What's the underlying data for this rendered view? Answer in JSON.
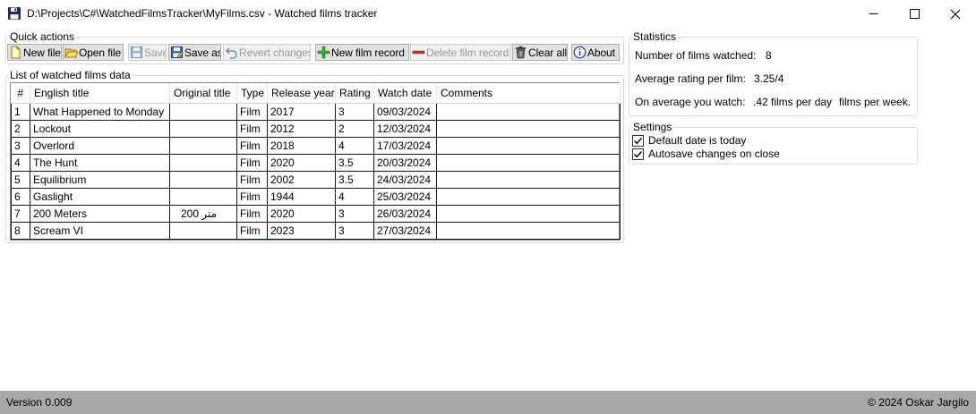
{
  "window": {
    "title": "D:\\Projects\\C#\\WatchedFilmsTracker\\MyFilms.csv - Watched films tracker",
    "app_icon": "floppy-disk-icon",
    "minimize_icon": "minimize-icon",
    "maximize_icon": "maximize-icon",
    "close_icon": "close-icon"
  },
  "quick_actions": {
    "label": "Quick actions",
    "buttons": [
      {
        "label": "New file",
        "icon": "new-file-icon",
        "enabled": true
      },
      {
        "label": "Open file",
        "icon": "open-folder-icon",
        "enabled": true
      },
      {
        "label": "Save",
        "icon": "save-icon",
        "enabled": false
      },
      {
        "label": "Save as",
        "icon": "save-as-icon",
        "enabled": true
      },
      {
        "label": "Revert changes",
        "icon": "undo-icon",
        "enabled": false
      },
      {
        "label": "New film record",
        "icon": "plus-icon",
        "enabled": true
      },
      {
        "label": "Delete film record",
        "icon": "minus-icon",
        "enabled": false
      },
      {
        "label": "Clear all",
        "icon": "trash-icon",
        "enabled": true
      },
      {
        "label": "About",
        "icon": "info-icon",
        "enabled": true
      }
    ]
  },
  "films": {
    "label": "List of watched films data",
    "columns": [
      "#",
      "English title",
      "Original title",
      "Type",
      "Release year",
      "Rating",
      "Watch date",
      "Comments"
    ],
    "rows": [
      [
        "1",
        "What Happened to Monday",
        "",
        "Film",
        "2017",
        "3",
        "09/03/2024",
        ""
      ],
      [
        "2",
        "Lockout",
        "",
        "Film",
        "2012",
        "2",
        "12/03/2024",
        ""
      ],
      [
        "3",
        "Overlord",
        "",
        "Film",
        "2018",
        "4",
        "17/03/2024",
        ""
      ],
      [
        "4",
        "The Hunt",
        "",
        "Film",
        "2020",
        "3.5",
        "20/03/2024",
        ""
      ],
      [
        "5",
        "Equilibrium",
        "",
        "Film",
        "2002",
        "3.5",
        "24/03/2024",
        ""
      ],
      [
        "6",
        "Gaslight",
        "",
        "Film",
        "1944",
        "4",
        "25/03/2024",
        ""
      ],
      [
        "7",
        "200 Meters",
        "200 متر",
        "Film",
        "2020",
        "3",
        "26/03/2024",
        ""
      ],
      [
        "8",
        "Scream VI",
        "",
        "Film",
        "2023",
        "3",
        "27/03/2024",
        ""
      ]
    ]
  },
  "statistics": {
    "label": "Statistics",
    "films_watched_label": "Number of films watched:",
    "films_watched_value": "8",
    "avg_rating_label": "Average rating per film:",
    "avg_rating_value": "3.25/4",
    "avg_watch_label": "On average you watch:",
    "avg_watch_day_value": ".42 films per day",
    "avg_watch_week_value": "films per week."
  },
  "settings": {
    "label": "Settings",
    "default_date_label": "Default date is today",
    "default_date_checked": true,
    "autosave_label": "Autosave changes on close",
    "autosave_checked": true
  },
  "status": {
    "version": "Version 0.009",
    "copyright": "© 2024 Oskar Jargilo"
  },
  "colors": {
    "statusbar": "#a9a9a9",
    "grid_border": "#7a8b96",
    "button_face": "#e1e1e1"
  }
}
